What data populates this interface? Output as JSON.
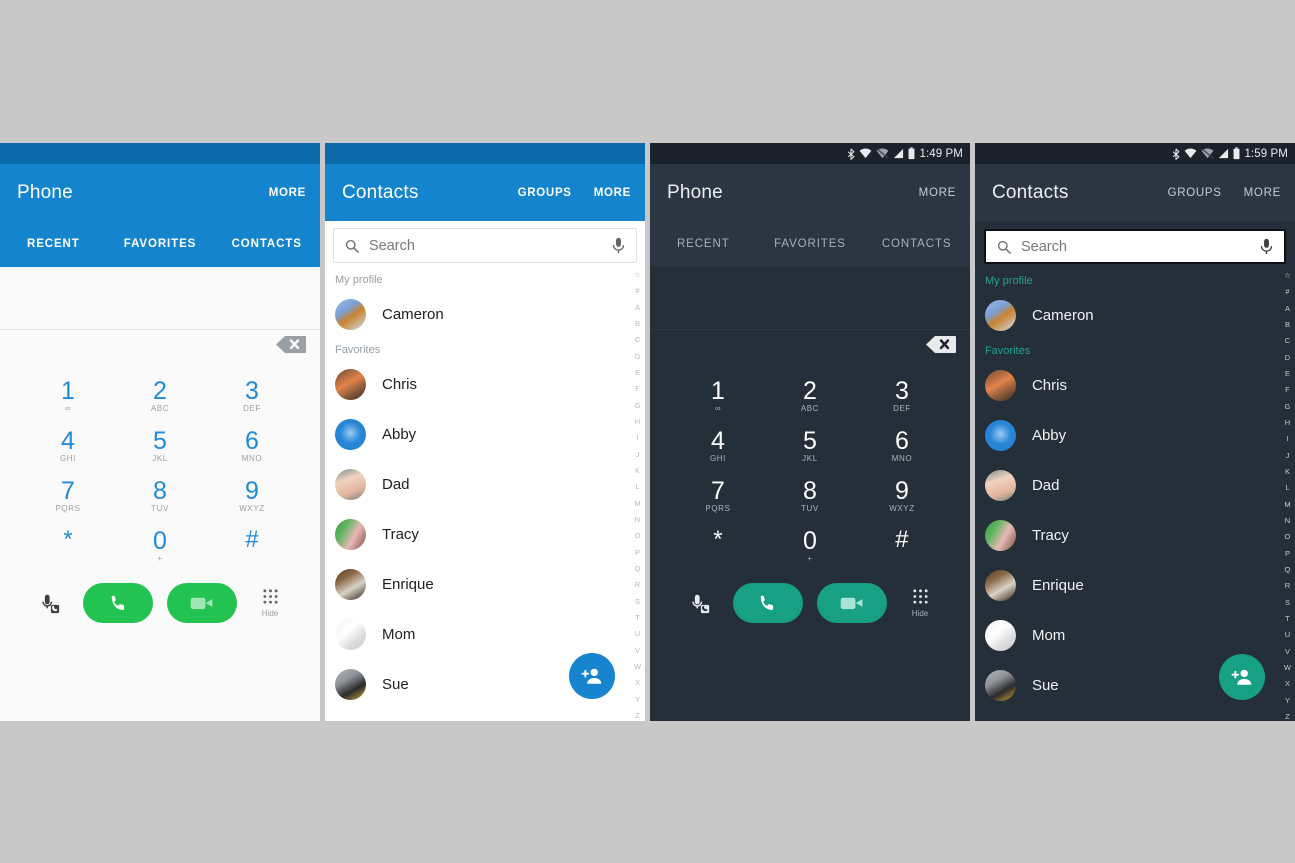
{
  "meta": {
    "page_bg": "#c8c8c8",
    "accent_blue": "#1485cd",
    "accent_green": "#22c351",
    "accent_teal": "#17a084",
    "dark_bg": "#242f3a",
    "dark_appbar": "#2b3642"
  },
  "panels": {
    "phone_light": {
      "title": "Phone",
      "more": "MORE",
      "tabs": [
        "RECENT",
        "FAVORITES",
        "CONTACTS"
      ]
    },
    "contacts_light": {
      "title": "Contacts",
      "groups": "GROUPS",
      "more": "MORE",
      "search_placeholder": "Search"
    },
    "phone_dark": {
      "title": "Phone",
      "more": "MORE",
      "tabs": [
        "RECENT",
        "FAVORITES",
        "CONTACTS"
      ],
      "status_time": "1:49 PM"
    },
    "contacts_dark": {
      "title": "Contacts",
      "groups": "GROUPS",
      "more": "MORE",
      "search_placeholder": "Search",
      "status_time": "1:59 PM"
    }
  },
  "dialpad": {
    "keys": [
      {
        "num": "1",
        "sub": "∞"
      },
      {
        "num": "2",
        "sub": "ABC"
      },
      {
        "num": "3",
        "sub": "DEF"
      },
      {
        "num": "4",
        "sub": "GHI"
      },
      {
        "num": "5",
        "sub": "JKL"
      },
      {
        "num": "6",
        "sub": "MNO"
      },
      {
        "num": "7",
        "sub": "PQRS"
      },
      {
        "num": "8",
        "sub": "TUV"
      },
      {
        "num": "9",
        "sub": "WXYZ"
      }
    ],
    "star": "*",
    "zero": "0",
    "zero_sub": "+",
    "hash": "#",
    "hide_label": "Hide"
  },
  "contacts": {
    "my_profile_label": "My profile",
    "favorites_label": "Favorites",
    "my_profile": [
      {
        "name": "Cameron",
        "c1": "#7a9fd4",
        "c2": "#d9a279",
        "c3": "#cfe0f2"
      }
    ],
    "favorites": [
      {
        "name": "Chris",
        "c1": "#8a5a3c",
        "c2": "#e2834a",
        "c3": "#3a2a1e"
      },
      {
        "name": "Abby",
        "c1": "#1b7fd4",
        "c2": "#7fbdf0",
        "c3": "#1465ad"
      },
      {
        "name": "Dad",
        "c1": "#e2b49c",
        "c2": "#f0d2bf",
        "c3": "#6d7f7d"
      },
      {
        "name": "Tracy",
        "c1": "#3f9b3f",
        "c2": "#e8b7b7",
        "c3": "#7a5040"
      },
      {
        "name": "Enrique",
        "c1": "#5a3a22",
        "c2": "#d8d2c6",
        "c3": "#2e1d10"
      },
      {
        "name": "Mom",
        "c1": "#e8e8e8",
        "c2": "#ffffff",
        "c3": "#c9c9c9"
      },
      {
        "name": "Sue",
        "c1": "#8f9399",
        "c2": "#2b2b2b",
        "c3": "#d2a53c"
      }
    ]
  },
  "index_letters": [
    "☆",
    "#",
    "A",
    "B",
    "C",
    "D",
    "E",
    "F",
    "G",
    "H",
    "I",
    "J",
    "K",
    "L",
    "M",
    "N",
    "O",
    "P",
    "Q",
    "R",
    "S",
    "T",
    "U",
    "V",
    "W",
    "X",
    "Y",
    "Z"
  ],
  "icons": {
    "bluetooth": "bluetooth-icon",
    "wifi": "wifi-icon",
    "wifi_alt": "wifi-alt-icon",
    "signal": "signal-bars-icon",
    "battery": "battery-icon",
    "search": "search-icon",
    "mic": "microphone-icon",
    "backspace": "backspace-icon",
    "call": "call-icon",
    "video": "video-call-icon",
    "voicemail": "voicemail-icon",
    "keypad": "keypad-icon",
    "add_contact": "add-contact-icon"
  }
}
